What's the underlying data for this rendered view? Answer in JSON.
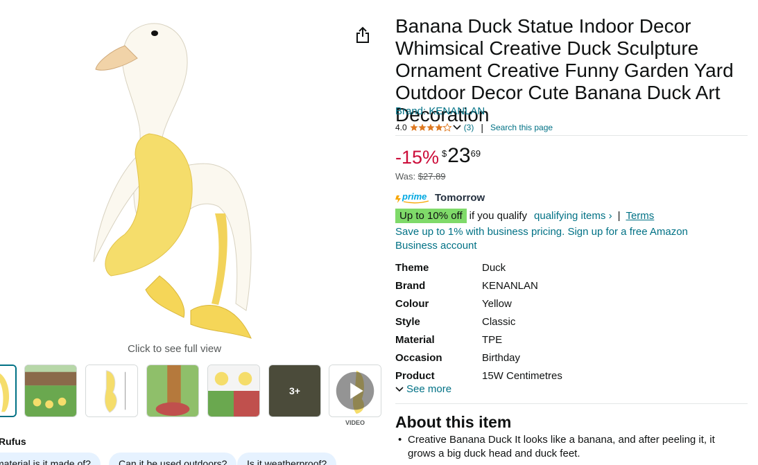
{
  "product": {
    "title": "Banana Duck Statue Indoor Decor Whimsical Creative Duck Sculpture Ornament Creative Funny Garden Yard Outdoor Decor Cute Banana Duck Art Decoration",
    "brand_link": "Brand: KENANLAN",
    "rating": "4.0",
    "review_count": "(3)",
    "rating_stars": 4,
    "search_page": "Search this page"
  },
  "media": {
    "click_full_view": "Click to see full view",
    "more_images": "3+",
    "video_label": "VIDEO",
    "share_icon": "share-icon"
  },
  "pricing": {
    "discount": "-15%",
    "currency": "$",
    "whole": "23",
    "fraction": "69",
    "was_label": "Was:",
    "was_price": "$27.89",
    "prime_delivery": "Tomorrow",
    "promo_badge": "Up to 10% off",
    "promo_text": "if you qualify",
    "qualifying_link": "qualifying items ›",
    "separator": "|",
    "terms_link": "Terms",
    "business_text": "Save up to 1% with business pricing. Sign up for a free Amazon Business account"
  },
  "specs": [
    {
      "key": "Theme",
      "value": "Duck"
    },
    {
      "key": "Brand",
      "value": "KENANLAN"
    },
    {
      "key": "Colour",
      "value": "Yellow"
    },
    {
      "key": "Style",
      "value": "Classic"
    },
    {
      "key": "Material",
      "value": "TPE"
    },
    {
      "key": "Occasion",
      "value": "Birthday"
    },
    {
      "key": "Product",
      "value": "15W Centimetres"
    }
  ],
  "see_more": "See more",
  "about": {
    "title": "About this item",
    "bullet_1": "Creative Banana Duck It looks like a banana, and after peeling it, it grows a big duck head and duck feet."
  },
  "rufus": {
    "title": "Rufus",
    "chips": [
      "material is it made of?",
      "Can it be used outdoors?",
      "Is it weatherproof?"
    ]
  },
  "colors": {
    "link": "#007185",
    "discount": "#cc0c39",
    "promo_badge": "#7fda69",
    "star": "#de7921"
  }
}
